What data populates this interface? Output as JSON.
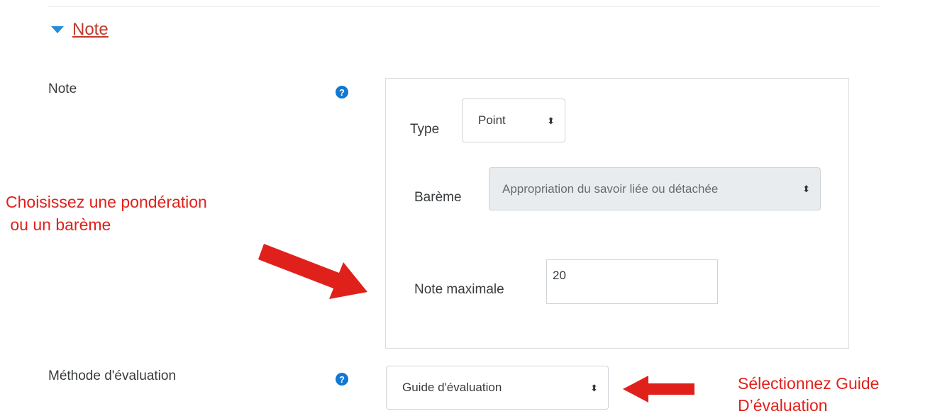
{
  "section": {
    "title": "Note"
  },
  "grade": {
    "label": "Note",
    "type_label": "Type",
    "type_value": "Point",
    "scale_label": "Barème",
    "scale_value": "Appropriation du savoir liée ou détachée",
    "maxgrade_label": "Note maximale",
    "maxgrade_value": "20"
  },
  "method": {
    "label": "Méthode d'évaluation",
    "value": "Guide d'évaluation"
  },
  "help_glyph": "?",
  "select_glyph": "⬍",
  "annotations": {
    "left_line1": "Choisissez une pondération",
    "left_line2": " ou un barème",
    "right_line1": "Sélectionnez Guide",
    "right_line2": "D’évaluation"
  },
  "colors": {
    "accent_blue": "#1177d1",
    "annotation_red": "#e0211b",
    "link_red": "#c0392b"
  }
}
